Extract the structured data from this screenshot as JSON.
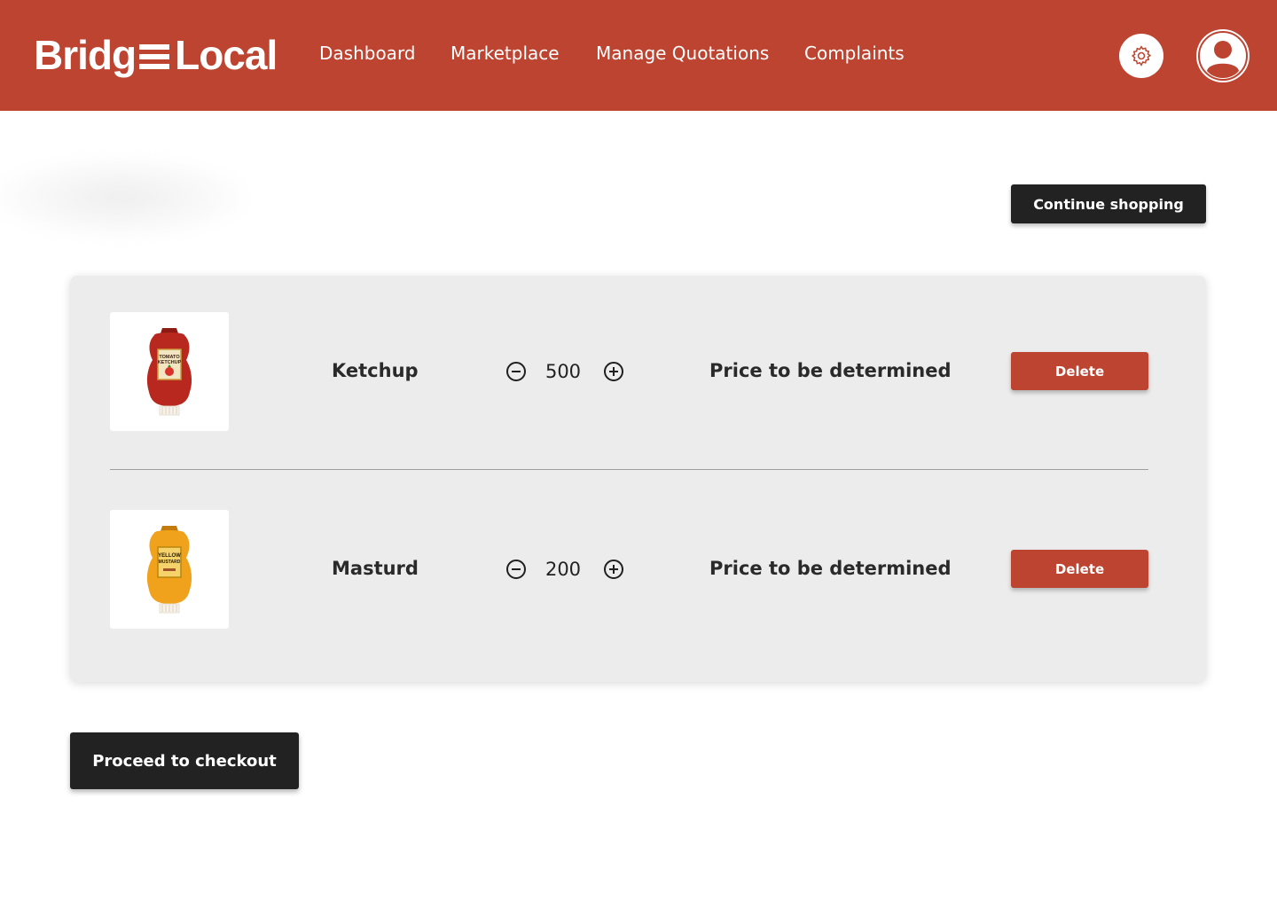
{
  "brand": {
    "name_left": "Bridg",
    "name_right": "Local",
    "color": "#bc4431"
  },
  "nav": {
    "items": [
      {
        "label": "Dashboard"
      },
      {
        "label": "Marketplace"
      },
      {
        "label": "Manage Quotations"
      },
      {
        "label": "Complaints"
      }
    ]
  },
  "header_icons": {
    "settings": "gear-icon",
    "profile": "user-icon"
  },
  "actions": {
    "continue_label": "Continue shopping",
    "checkout_label": "Proceed to checkout"
  },
  "cart": {
    "items": [
      {
        "name": "Ketchup",
        "quantity": "500",
        "price": "Price to be determined",
        "delete_label": "Delete",
        "image_icon": "ketchup-bottle-icon",
        "bottle_color": "#b8281f",
        "label_text": "TOMATO KETCHUP"
      },
      {
        "name": "Masturd",
        "quantity": "200",
        "price": "Price to be determined",
        "delete_label": "Delete",
        "image_icon": "mustard-bottle-icon",
        "bottle_color": "#f0a21c",
        "label_text": "YELLOW MUSTARD"
      }
    ]
  }
}
